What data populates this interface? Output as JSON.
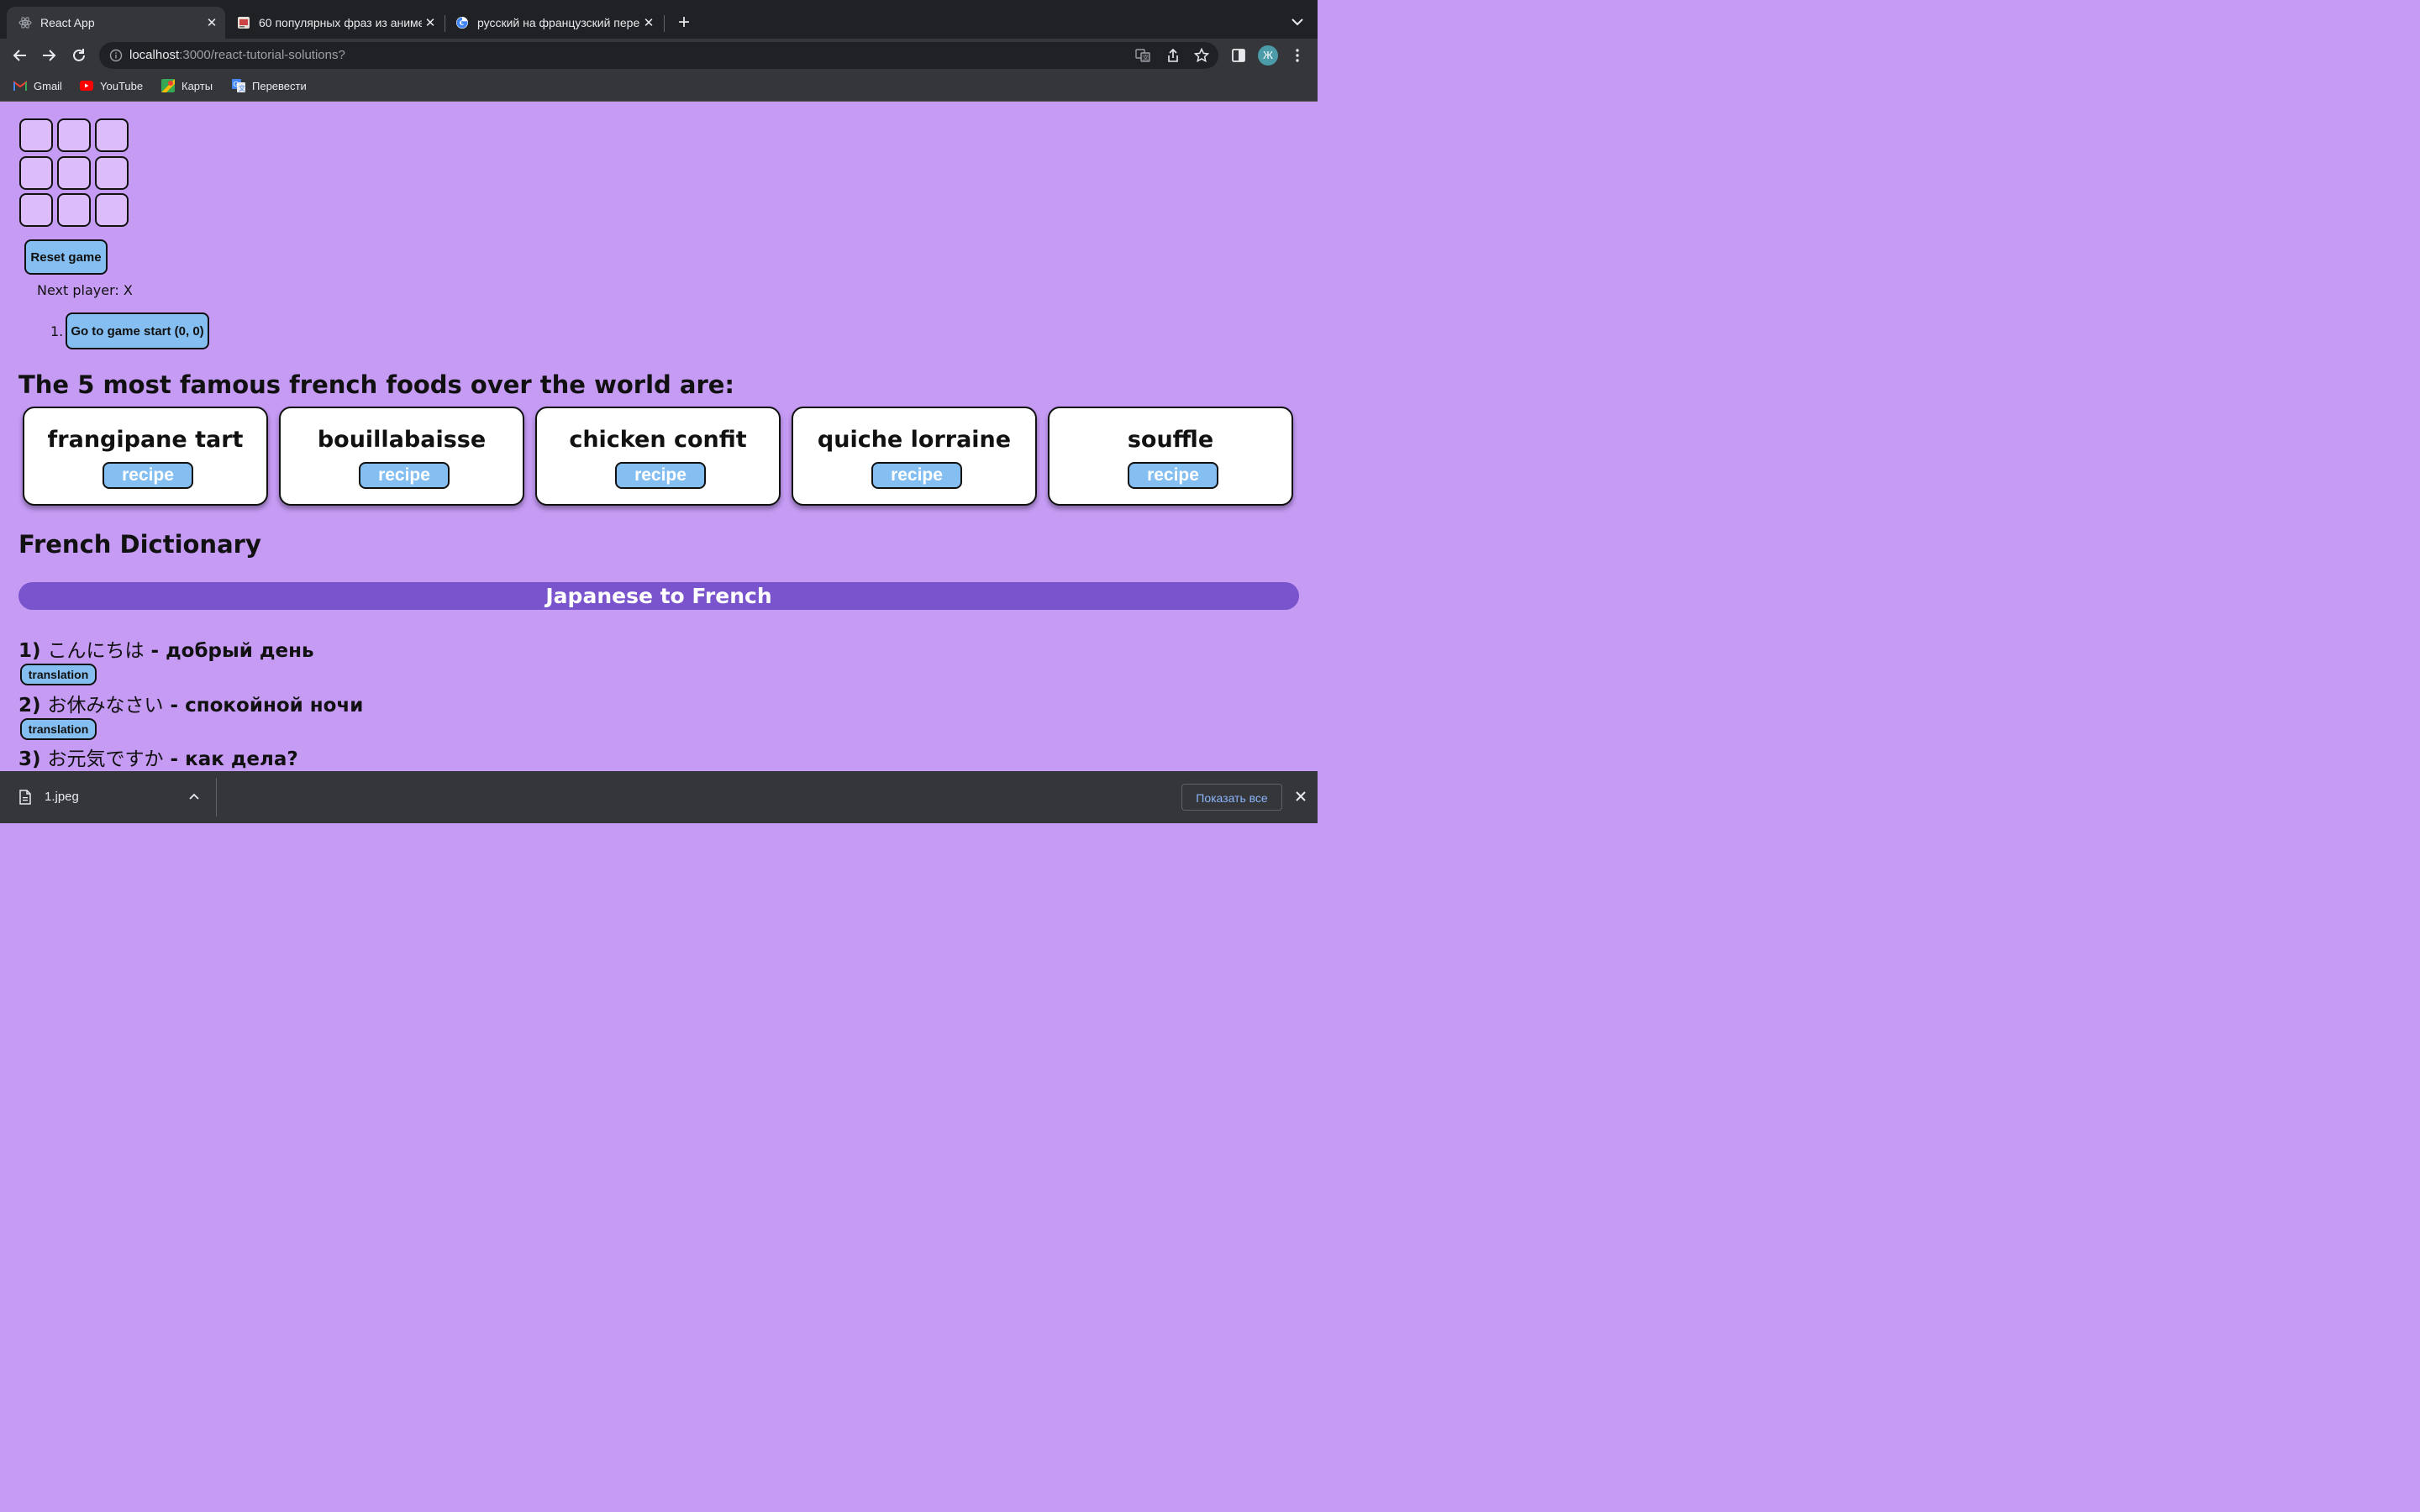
{
  "browser": {
    "tabs": [
      {
        "title": "React App",
        "icon": "react-icon",
        "active": true
      },
      {
        "title": "60 популярных фраз из аниме",
        "icon": "page-thumbnail-icon",
        "active": false
      },
      {
        "title": "русский на французский перевод",
        "icon": "google-icon",
        "active": false
      }
    ],
    "url": {
      "host": "localhost",
      "path": ":3000/react-tutorial-solutions?"
    },
    "profile_initial": "Ж",
    "bookmarks": [
      {
        "label": "Gmail",
        "icon": "gmail-icon"
      },
      {
        "label": "YouTube",
        "icon": "youtube-icon"
      },
      {
        "label": "Карты",
        "icon": "maps-icon"
      },
      {
        "label": "Перевести",
        "icon": "translate-icon"
      }
    ]
  },
  "game": {
    "board": [
      "",
      "",
      "",
      "",
      "",
      "",
      "",
      "",
      ""
    ],
    "reset_label": "Reset game",
    "status": "Next player: X",
    "moves": [
      {
        "number": "1.",
        "label": "Go to game start (0, 0)"
      }
    ]
  },
  "foods": {
    "heading": "The 5 most famous french foods over the world are:",
    "items": [
      {
        "name": "frangipane tart",
        "button": "recipe"
      },
      {
        "name": "bouillabaisse",
        "button": "recipe"
      },
      {
        "name": "chicken confit",
        "button": "recipe"
      },
      {
        "name": "quiche lorraine",
        "button": "recipe"
      },
      {
        "name": "souffle",
        "button": "recipe"
      }
    ]
  },
  "dictionary": {
    "heading": "French Dictionary",
    "bar_title": "Japanese to French",
    "entries": [
      {
        "num": "1)",
        "japanese": "こんにちは",
        "sep": " - ",
        "translation": "добрый день",
        "button": "translation"
      },
      {
        "num": "2)",
        "japanese": "お休みなさい",
        "sep": " - ",
        "translation": "спокойной ночи",
        "button": "translation"
      },
      {
        "num": "3)",
        "japanese": "お元気ですか",
        "sep": " - ",
        "translation": "как дела?"
      }
    ]
  },
  "downloads": {
    "file_name": "1.jpeg",
    "show_all": "Показать все"
  },
  "colors": {
    "page_bg": "#c59bf4",
    "button_blue": "#85bef0",
    "bar_purple": "#7a54cc",
    "square_fill": "#dcbcfb"
  }
}
